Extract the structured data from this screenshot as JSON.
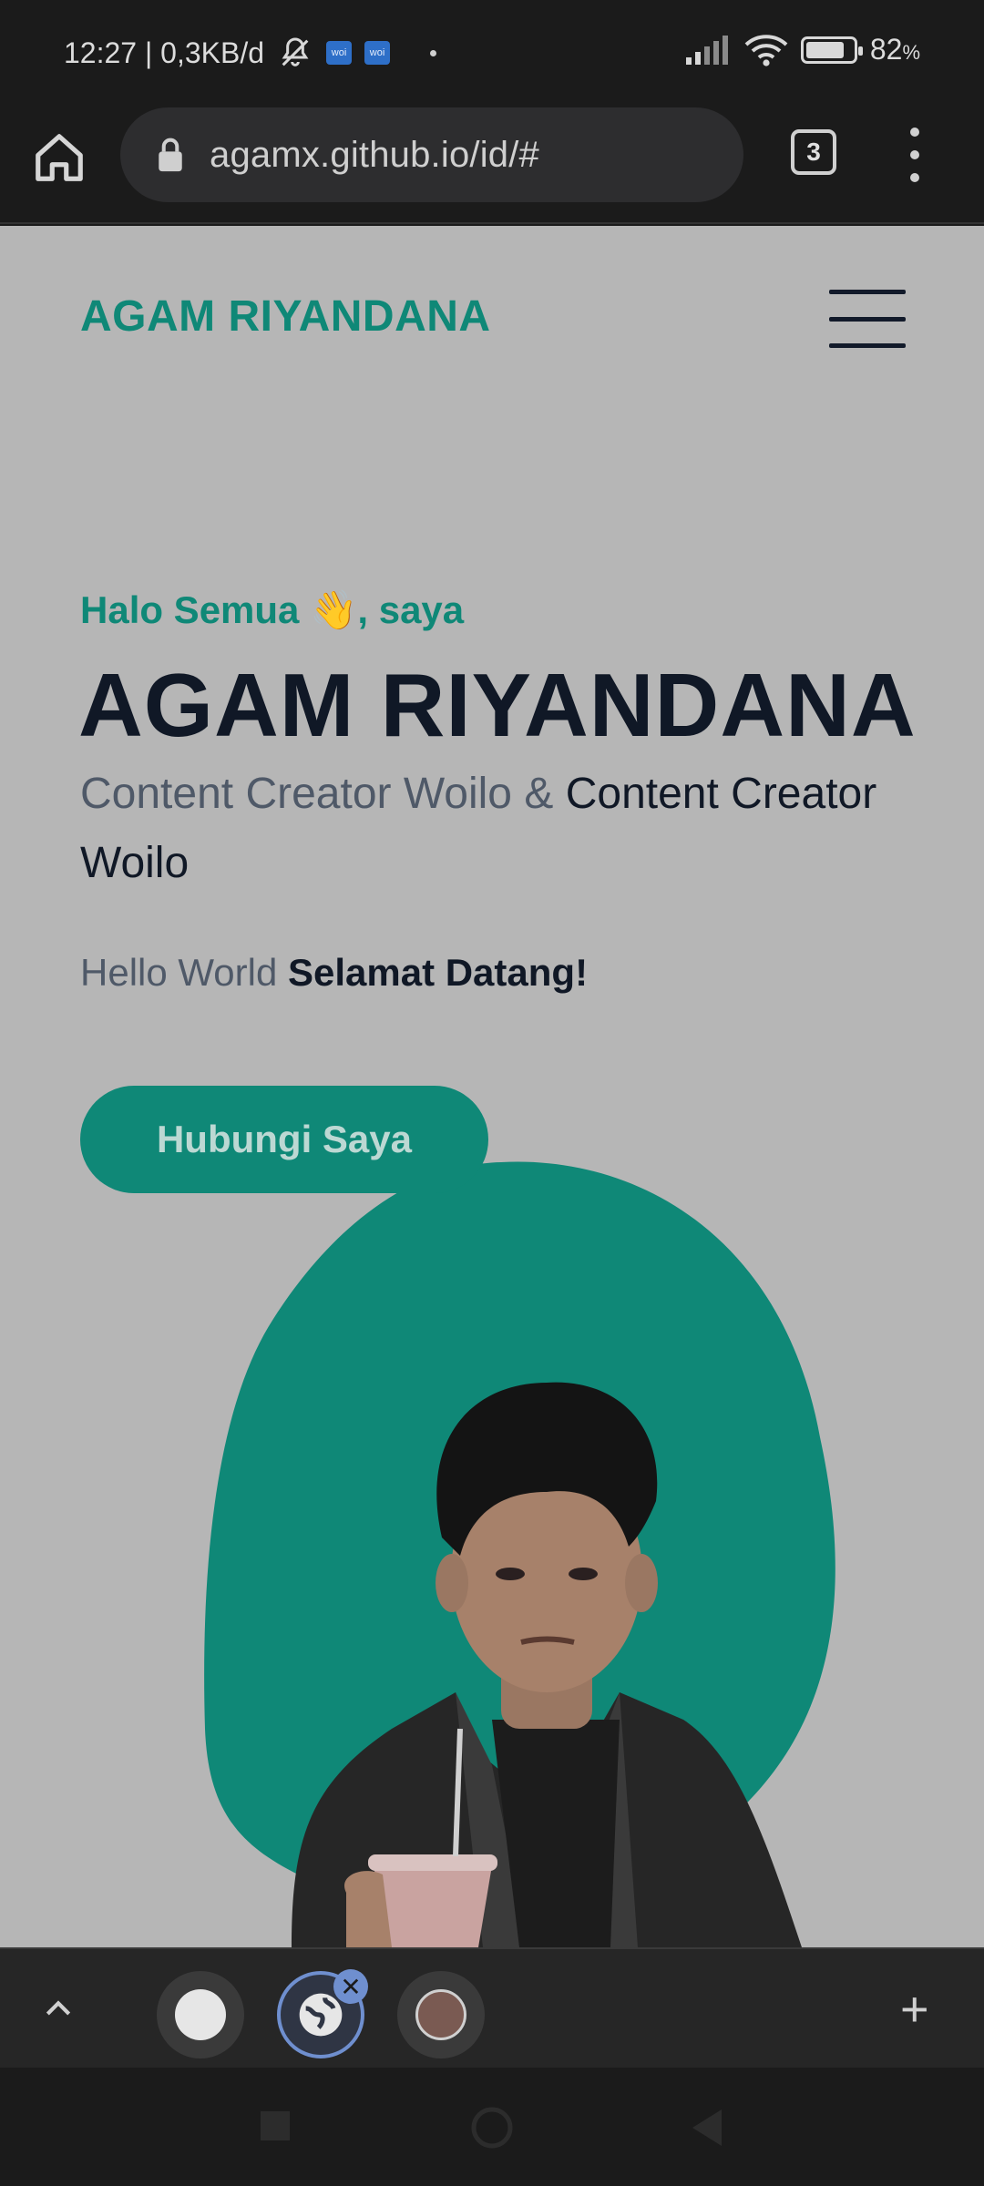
{
  "status_bar": {
    "time_and_speed": "12:27 | 0,3KB/d",
    "notif_icon_1": "woi",
    "notif_icon_2": "woi",
    "battery_percent": "82",
    "battery_unit": "%",
    "battery_level": 0.82,
    "icons": [
      "bell-off-icon",
      "signal-icon",
      "wifi-icon",
      "battery-icon"
    ]
  },
  "browser": {
    "url": "agamx.github.io/id/#",
    "tab_count": "3",
    "icons": [
      "home-icon",
      "lock-icon",
      "more-vert-icon"
    ]
  },
  "site": {
    "brand": "AGAM RIYANDANA",
    "greeting": "Halo Semua 👋, saya",
    "name": "AGAM RIYANDANA",
    "role_muted": "Content Creator Woilo &",
    "role_typed": "Content Creator Woilo",
    "hello_muted": "Hello World",
    "hello_bold": "Selamat Datang!",
    "cta_label": "Hubungi Saya",
    "accent_color": "#0f8877",
    "dark_text_color": "#101826"
  },
  "tab_strip": {
    "icons": [
      "chevron-up-icon",
      "tab-thumbnail-blank",
      "tab-thumbnail-globe",
      "tab-thumbnail-photo",
      "close-icon",
      "plus-icon"
    ],
    "add_label": "+"
  },
  "nav_bar": {
    "icons": [
      "recents-icon",
      "home-icon",
      "back-icon"
    ]
  }
}
